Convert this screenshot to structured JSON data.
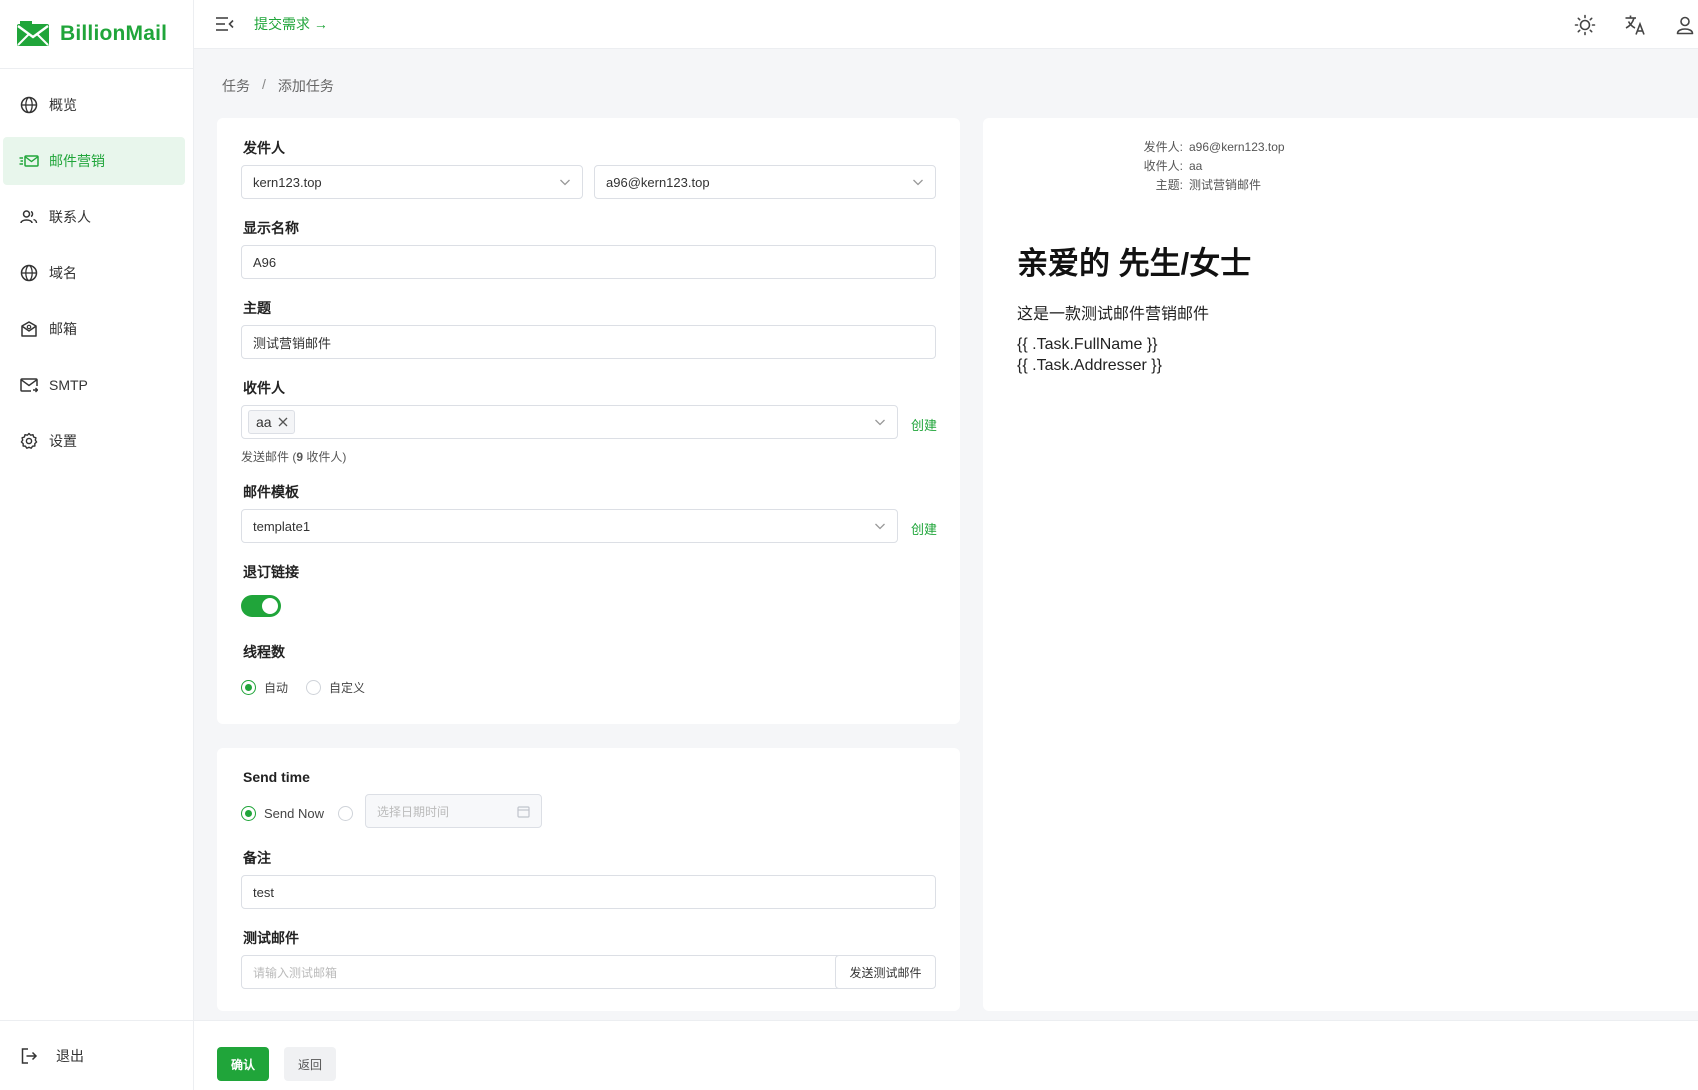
{
  "app": {
    "name": "BillionMail"
  },
  "sidebar": {
    "items": [
      {
        "label": "概览",
        "icon": "globe-icon"
      },
      {
        "label": "邮件营销",
        "icon": "mail-send-icon",
        "active": true
      },
      {
        "label": "联系人",
        "icon": "users-icon"
      },
      {
        "label": "域名",
        "icon": "globe-icon"
      },
      {
        "label": "邮箱",
        "icon": "mailbox-icon"
      },
      {
        "label": "SMTP",
        "icon": "smtp-mail-icon"
      },
      {
        "label": "设置",
        "icon": "gear-icon"
      }
    ],
    "logout_label": "退出"
  },
  "header": {
    "submit_link": "提交需求 →"
  },
  "breadcrumb": {
    "parent": "任务",
    "separator": "/",
    "current": "添加任务"
  },
  "form": {
    "sender_label": "发件人",
    "sender_domain": "kern123.top",
    "sender_email": "a96@kern123.top",
    "display_name_label": "显示名称",
    "display_name": "A96",
    "subject_label": "主题",
    "subject": "测试营销邮件",
    "recipients_label": "收件人",
    "recipient_tag": "aa",
    "create_label": "创建",
    "recipients_hint_prefix": "发送邮件 (",
    "recipients_count": "9",
    "recipients_hint_suffix": " 收件人)",
    "template_label": "邮件模板",
    "template": "template1",
    "unsubscribe_label": "退订链接",
    "unsubscribe_enabled": true,
    "threads_label": "线程数",
    "thread_options": [
      "自动",
      "自定义"
    ],
    "thread_selected": "自动"
  },
  "schedule": {
    "send_time_label": "Send time",
    "send_now_label": "Send Now",
    "datetime_placeholder": "选择日期时间",
    "note_label": "备注",
    "note": "test",
    "test_email_label": "测试邮件",
    "test_email_placeholder": "请输入测试邮箱",
    "send_test_button": "发送测试邮件"
  },
  "footer": {
    "confirm_button": "确认",
    "back_button": "返回"
  },
  "preview": {
    "from_key": "发件人:",
    "from_value": "a96@kern123.top",
    "to_key": "收件人:",
    "to_value": "aa",
    "subject_key": "主题:",
    "subject_value": "测试营销邮件",
    "heading": "亲爱的 先生/女士",
    "body": "这是一款测试邮件营销邮件",
    "var1": "{{ .Task.FullName }}",
    "var2": "{{ .Task.Addresser }}"
  },
  "colors": {
    "accent": "#20a53a",
    "active_bg": "#e8f6ec",
    "page_bg": "#f5f6f8"
  }
}
